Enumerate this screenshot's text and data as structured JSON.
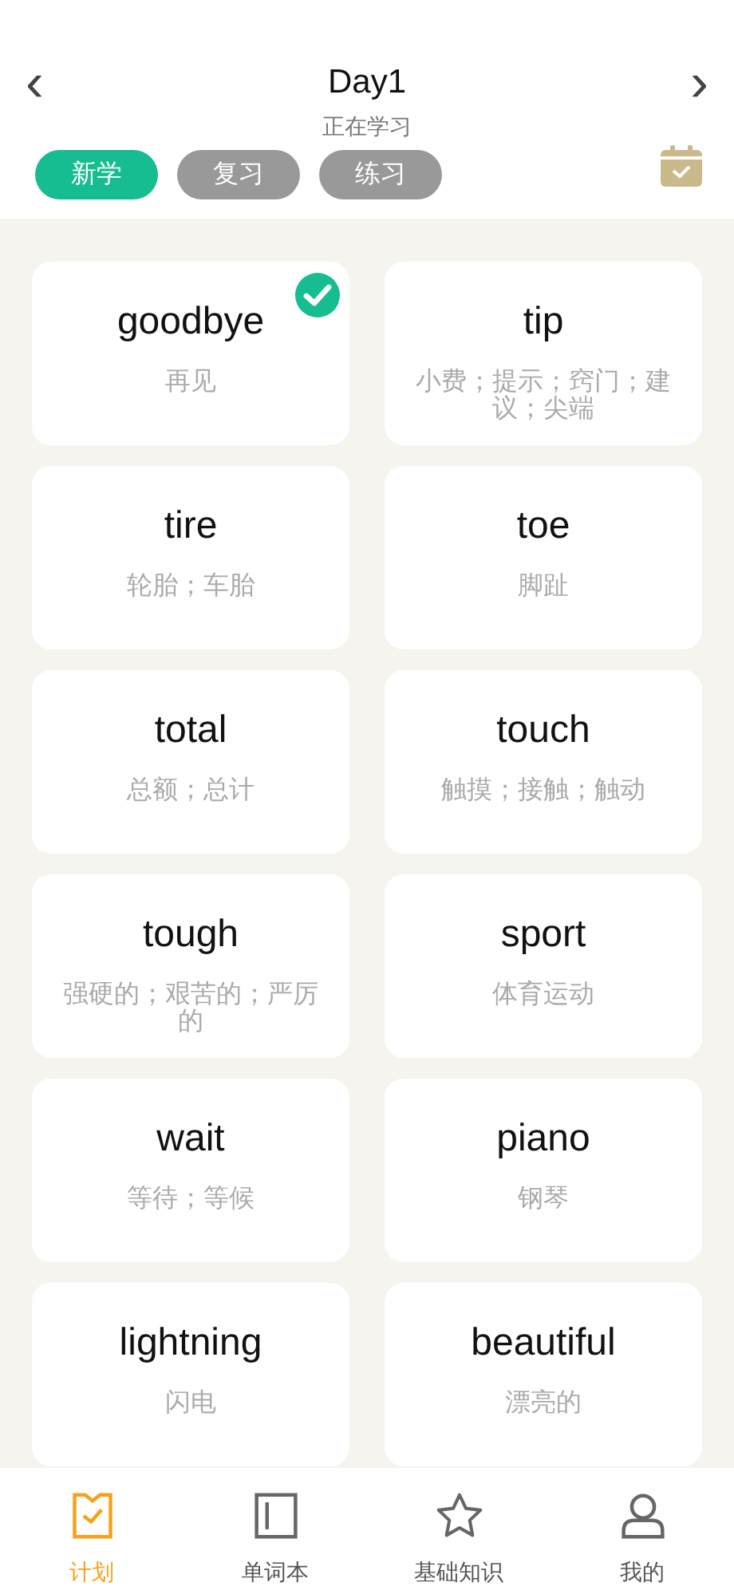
{
  "header": {
    "prev": "‹",
    "title": "Day1",
    "next": "›",
    "subtitle": "正在学习"
  },
  "modes": [
    {
      "label": "新学",
      "selected": true
    },
    {
      "label": "复习",
      "selected": false
    },
    {
      "label": "练习",
      "selected": false
    }
  ],
  "cards": [
    {
      "word": "goodbye",
      "meaning": "再见",
      "checked": true
    },
    {
      "word": "tip",
      "meaning": "小费；提示；窍门；建议；尖端",
      "checked": false
    },
    {
      "word": "tire",
      "meaning": "轮胎；车胎",
      "checked": false
    },
    {
      "word": "toe",
      "meaning": "脚趾",
      "checked": false
    },
    {
      "word": "total",
      "meaning": "总额；总计",
      "checked": false
    },
    {
      "word": "touch",
      "meaning": "触摸；接触；触动",
      "checked": false
    },
    {
      "word": "tough",
      "meaning": "强硬的；艰苦的；严厉的",
      "checked": false
    },
    {
      "word": "sport",
      "meaning": "体育运动",
      "checked": false
    },
    {
      "word": "wait",
      "meaning": "等待；等候",
      "checked": false
    },
    {
      "word": "piano",
      "meaning": "钢琴",
      "checked": false
    },
    {
      "word": "lightning",
      "meaning": "闪电",
      "checked": false
    },
    {
      "word": "beautiful",
      "meaning": "漂亮的",
      "checked": false
    }
  ],
  "tabs": [
    {
      "label": "计划",
      "kind": "plan",
      "selected": true
    },
    {
      "label": "单词本",
      "kind": "book",
      "selected": false
    },
    {
      "label": "基础知识",
      "kind": "star",
      "selected": false
    },
    {
      "label": "我的",
      "kind": "person",
      "selected": false
    }
  ]
}
